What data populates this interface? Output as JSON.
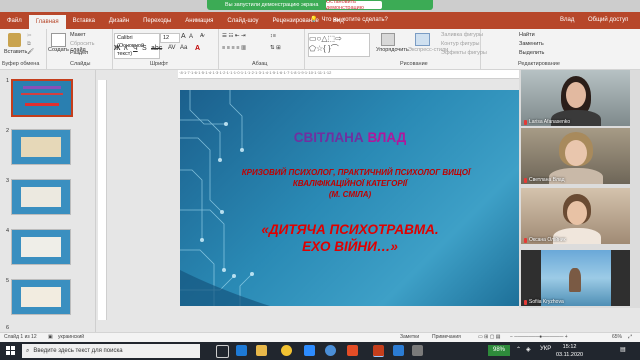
{
  "share_bar": {
    "notice": "Вы запустили демонстрацию экрана",
    "stop_label": "Остановить демонстрацию"
  },
  "tabs": [
    "Файл",
    "Главная",
    "Вставка",
    "Дизайн",
    "Переходы",
    "Анимация",
    "Слайд-шоу",
    "Рецензирование",
    "Вид"
  ],
  "tell_me": "Что вы хотите сделать?",
  "user": "Влад",
  "share": "Общий доступ",
  "ribbon": {
    "clipboard": {
      "paste": "Вставить",
      "cut": "Вырезать",
      "copy": "Копировать",
      "format": "Формат по образцу",
      "label": "Буфер обмена"
    },
    "slides": {
      "new_slide": "Создать слайд",
      "layout": "Макет",
      "reset": "Сбросить",
      "section": "Раздел",
      "label": "Слайды"
    },
    "font": {
      "family": "Calibri (Основной текст)",
      "size": "12",
      "label": "Шрифт"
    },
    "paragraph": {
      "label": "Абзац"
    },
    "drawing": {
      "arrange": "Упорядочить",
      "quick_styles": "Экспресс-стили",
      "fill": "Заливка фигуры",
      "outline": "Контур фигуры",
      "effects": "Эффекты фигуры",
      "label": "Рисование"
    },
    "editing": {
      "find": "Найти",
      "replace": "Заменить",
      "select": "Выделить",
      "label": "Редактирование"
    }
  },
  "thumbnails": [
    "1",
    "2",
    "3",
    "4",
    "5",
    "6"
  ],
  "slide": {
    "name_1": "СВІТЛАНА",
    "name_2": "ВЛАД",
    "subtitle_1": "КРИЗОВИЙ ПСИХОЛОГ, ПРАКТИЧНИЙ ПСИХОЛОГ ВИЩОЇ",
    "subtitle_2": "КВАЛІФІКАЦІЙНОЇ КАТЕГОРІЇ",
    "subtitle_3": "(М. СМІЛА)",
    "title_1": "«ДИТЯЧА ПСИХОТРАВМА.",
    "title_2": "ЕХО ВІЙНИ…»"
  },
  "participants": [
    "Larisa Afanasenko",
    "Светлана Влад",
    "Оксана Олійник",
    "Sofiia Kryzhova"
  ],
  "status": {
    "slide_info": "Слайд 1 из 12",
    "language": "украинский",
    "notes": "Заметки",
    "comments": "Примечания",
    "zoom": "65%"
  },
  "taskbar": {
    "search_placeholder": "Введите здесь текст для поиска",
    "battery": "98%",
    "lang": "УКР",
    "time": "15:12",
    "date": "03.11.2020"
  },
  "colors": {
    "ribbon": "#b7472a",
    "share_green": "#3cab55",
    "slide_bg": "#2a8ab5"
  }
}
